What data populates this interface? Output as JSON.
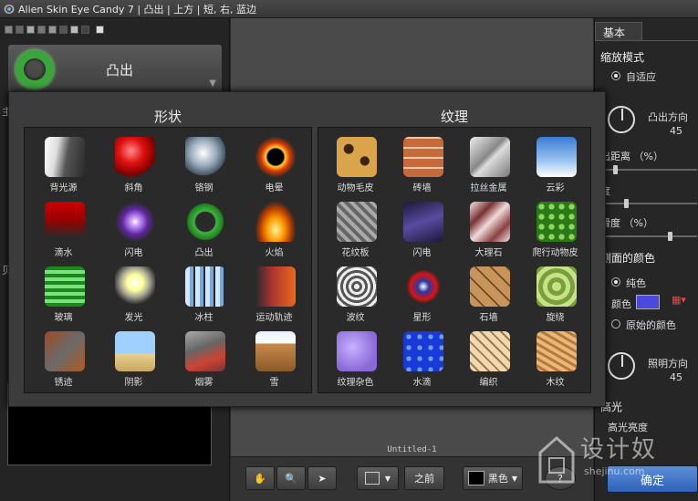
{
  "title": "Alien Skin Eye Candy 7 | 凸出 | 上方 | 短, 右, 蓝边",
  "effect": {
    "name": "凸出"
  },
  "left_labels": [
    "主",
    "贝"
  ],
  "canvas": {
    "doc_name": "Untitled-1"
  },
  "bottom": {
    "prev_label": "之前",
    "bg_label": "黑色",
    "help": "?"
  },
  "right": {
    "tab": "基本",
    "zoom_mode": "缩放模式",
    "zoom_opt": "自适应",
    "dir_label": "凸出方向",
    "dir_value": "45",
    "dist_label": "出距离 （%）",
    "width_label": "度",
    "smooth_label": "滑度 （%）",
    "side_color": "侧面的颜色",
    "solid": "纯色",
    "color": "颜色",
    "orig": "原始的颜色",
    "light_dir": "照明方向",
    "light_val": "45",
    "highlight": "高光",
    "hl_bright": "高光亮度",
    "ok": "确定"
  },
  "shapes": {
    "title": "形状",
    "items": [
      {
        "label": "背光源",
        "icon": "backlight"
      },
      {
        "label": "斜角",
        "icon": "bevel"
      },
      {
        "label": "铬钢",
        "icon": "chrome"
      },
      {
        "label": "电晕",
        "icon": "corona"
      },
      {
        "label": "滴水",
        "icon": "drip"
      },
      {
        "label": "闪电",
        "icon": "lightning"
      },
      {
        "label": "凸出",
        "icon": "extrude"
      },
      {
        "label": "火焰",
        "icon": "fire"
      },
      {
        "label": "玻璃",
        "icon": "glass"
      },
      {
        "label": "发光",
        "icon": "glow"
      },
      {
        "label": "冰柱",
        "icon": "icicles"
      },
      {
        "label": "运动轨迹",
        "icon": "motion"
      },
      {
        "label": "锈迹",
        "icon": "rust"
      },
      {
        "label": "阴影",
        "icon": "shadow"
      },
      {
        "label": "烟雾",
        "icon": "smoke"
      },
      {
        "label": "雪",
        "icon": "snow"
      }
    ]
  },
  "textures": {
    "title": "纹理",
    "items": [
      {
        "label": "动物毛皮",
        "icon": "fur"
      },
      {
        "label": "砖墙",
        "icon": "brick"
      },
      {
        "label": "拉丝金属",
        "icon": "brushed-metal"
      },
      {
        "label": "云彩",
        "icon": "clouds"
      },
      {
        "label": "花纹板",
        "icon": "diamond-plate"
      },
      {
        "label": "闪电",
        "icon": "lightning-tex"
      },
      {
        "label": "大理石",
        "icon": "marble"
      },
      {
        "label": "爬行动物皮",
        "icon": "reptile"
      },
      {
        "label": "波纹",
        "icon": "ripples"
      },
      {
        "label": "星形",
        "icon": "star"
      },
      {
        "label": "石墙",
        "icon": "stone"
      },
      {
        "label": "旋绕",
        "icon": "swirl"
      },
      {
        "label": "纹理杂色",
        "icon": "noise"
      },
      {
        "label": "水滴",
        "icon": "drops"
      },
      {
        "label": "编织",
        "icon": "weave"
      },
      {
        "label": "木纹",
        "icon": "wood"
      }
    ]
  },
  "watermark": {
    "text": "设计奴",
    "url": "shejinu.com"
  }
}
